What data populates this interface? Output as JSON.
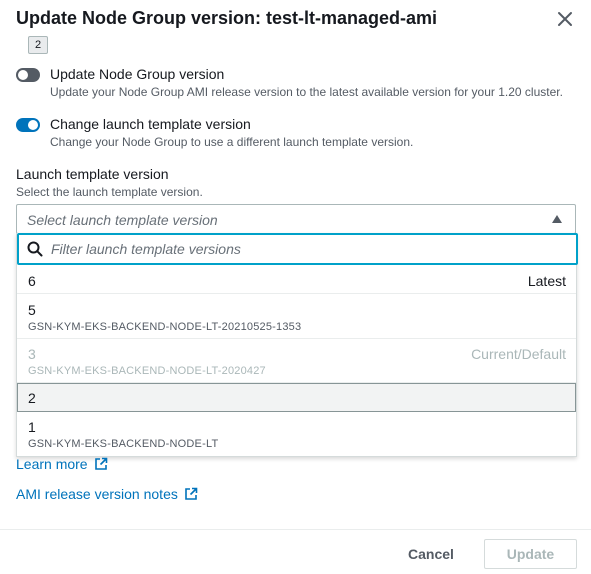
{
  "modal": {
    "title": "Update Node Group version: test-lt-managed-ami",
    "tooltip": "2"
  },
  "options": {
    "update_node_group": {
      "label": "Update Node Group version",
      "description": "Update your Node Group AMI release version to the latest available version for your 1.20 cluster.",
      "checked": false
    },
    "change_launch_template": {
      "label": "Change launch template version",
      "description": "Change your Node Group to use a different launch template version.",
      "checked": true
    }
  },
  "launch_template": {
    "label": "Launch template version",
    "description": "Select the launch template version.",
    "placeholder": "Select launch template version",
    "filter_placeholder": "Filter launch template versions",
    "versions": [
      {
        "label": "6",
        "tag": "Latest",
        "description": "",
        "disabled": false,
        "highlighted": false
      },
      {
        "label": "5",
        "tag": "",
        "description": "GSN-KYM-EKS-BACKEND-NODE-LT-20210525-1353",
        "disabled": false,
        "highlighted": false
      },
      {
        "label": "3",
        "tag": "Current/Default",
        "description": "GSN-KYM-EKS-BACKEND-NODE-LT-2020427",
        "disabled": true,
        "highlighted": false
      },
      {
        "label": "2",
        "tag": "",
        "description": "",
        "disabled": false,
        "highlighted": true
      },
      {
        "label": "1",
        "tag": "",
        "description": "GSN-KYM-EKS-BACKEND-NODE-LT",
        "disabled": false,
        "highlighted": false
      }
    ]
  },
  "links": {
    "learn_more": "Learn more",
    "ami_notes": "AMI release version notes"
  },
  "footer": {
    "cancel_label": "Cancel",
    "update_label": "Update"
  },
  "colors": {
    "accent": "#0073bb",
    "focus": "#00a1c9",
    "toggle_off": "#545b64"
  },
  "icons": {
    "close": "close-icon",
    "caret": "caret-up-icon",
    "search": "search-icon",
    "external": "external-link-icon"
  }
}
